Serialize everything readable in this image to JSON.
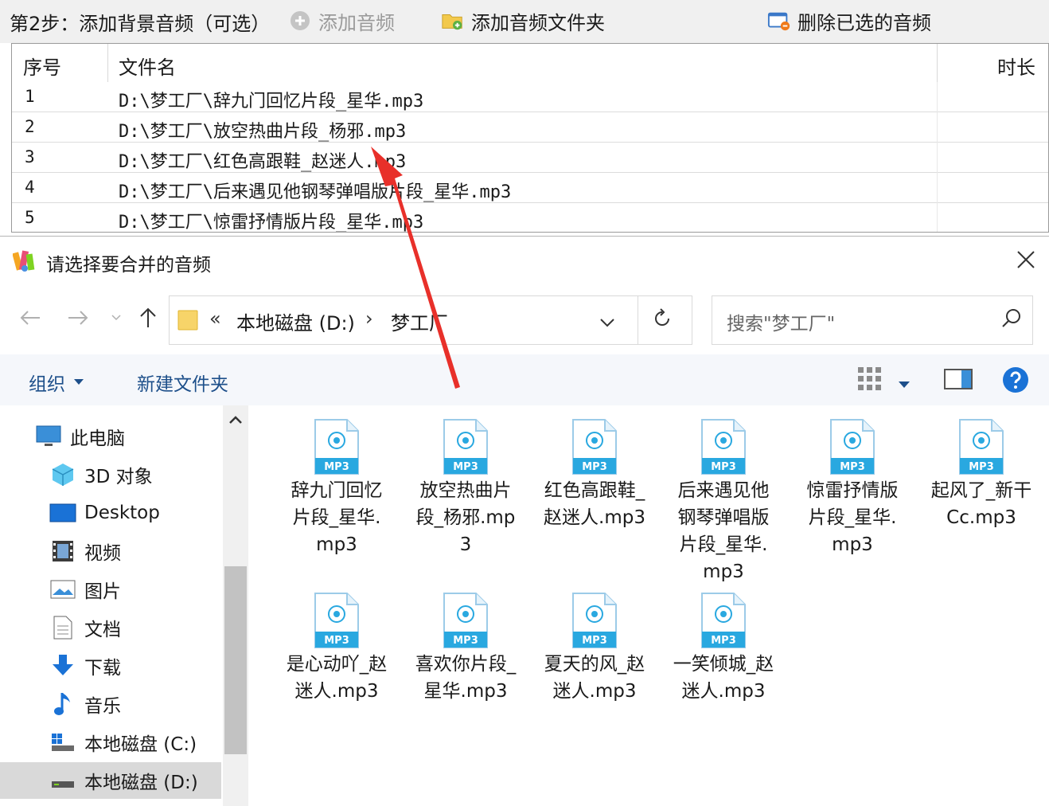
{
  "toolbar": {
    "step_title": "第2步：添加背景音频（可选）",
    "add_audio": "添加音频",
    "add_folder": "添加音频文件夹",
    "delete_selected": "删除已选的音频"
  },
  "list": {
    "columns": [
      "序号",
      "文件名",
      "时长"
    ],
    "rows": [
      {
        "idx": "1",
        "path": "D:\\梦工厂\\辞九门回忆片段_星华.mp3"
      },
      {
        "idx": "2",
        "path": "D:\\梦工厂\\放空热曲片段_杨邪.mp3"
      },
      {
        "idx": "3",
        "path": "D:\\梦工厂\\红色高跟鞋_赵迷人.mp3"
      },
      {
        "idx": "4",
        "path": "D:\\梦工厂\\后来遇见他钢琴弹唱版片段_星华.mp3"
      },
      {
        "idx": "5",
        "path": "D:\\梦工厂\\惊雷抒情版片段_星华.mp3"
      }
    ]
  },
  "dialog": {
    "title": "请选择要合并的音频",
    "breadcrumb": [
      "本地磁盘 (D:)",
      "梦工厂"
    ],
    "search_placeholder": "搜索\"梦工厂\"",
    "organize": "组织",
    "new_folder": "新建文件夹",
    "nav": [
      "此电脑",
      "3D 对象",
      "Desktop",
      "视频",
      "图片",
      "文档",
      "下载",
      "音乐",
      "本地磁盘 (C:)",
      "本地磁盘 (D:)"
    ],
    "files": [
      "辞九门回忆片段_星华.mp3",
      "放空热曲片段_杨邪.mp3",
      "红色高跟鞋_赵迷人.mp3",
      "后来遇见他钢琴弹唱版片段_星华.mp3",
      "惊雷抒情版片段_星华.mp3",
      "起风了_新干Cc.mp3",
      "是心动吖_赵迷人.mp3",
      "喜欢你片段_星华.mp3",
      "夏天的风_赵迷人.mp3",
      "一笑倾城_赵迷人.mp3"
    ],
    "file_badge": "MP3"
  },
  "colors": {
    "accent_blue": "#1d4f8a",
    "mp3_blue": "#29a8e0",
    "arrow_red": "#e8302a",
    "selected_bg": "#d9d9d9"
  },
  "icons": [
    "plus-circle-icon",
    "folder-add-icon",
    "delete-icon",
    "app-icon",
    "close-icon",
    "back-arrow-icon",
    "forward-arrow-icon",
    "up-arrow-icon",
    "folder-icon",
    "refresh-icon",
    "search-icon",
    "view-grid-icon",
    "preview-pane-icon",
    "help-icon",
    "mp3-file-icon"
  ]
}
